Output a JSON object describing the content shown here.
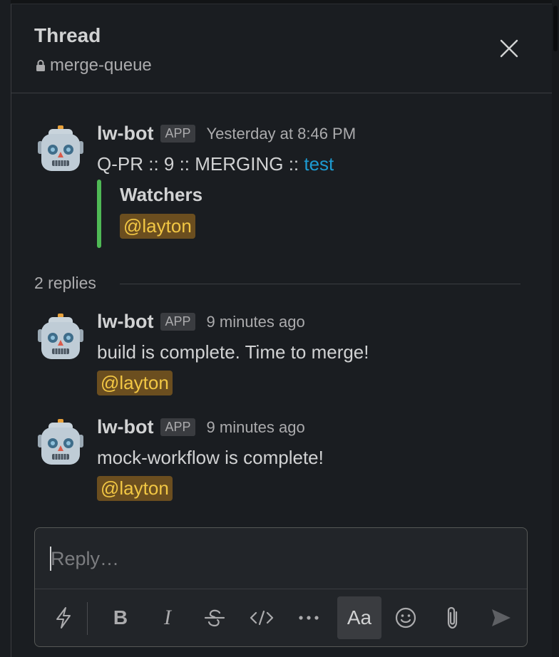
{
  "header": {
    "title": "Thread",
    "channel": "merge-queue"
  },
  "parent_message": {
    "author": "lw-bot",
    "badge": "APP",
    "time": "Yesterday at 8:46 PM",
    "text_prefix": "Q-PR :: 9 :: MERGING :: ",
    "link_text": "test",
    "attachment": {
      "title": "Watchers",
      "mention": "@layton",
      "accent_color": "#4fb955"
    }
  },
  "replies_label": "2 replies",
  "replies": [
    {
      "author": "lw-bot",
      "badge": "APP",
      "time": "9 minutes ago",
      "text": "build is complete. Time to merge!",
      "mention": "@layton"
    },
    {
      "author": "lw-bot",
      "badge": "APP",
      "time": "9 minutes ago",
      "text": "mock-workflow is complete!",
      "mention": "@layton"
    }
  ],
  "composer": {
    "placeholder": "Reply…",
    "toolbar": [
      "shortcuts-icon",
      "bold-icon",
      "italic-icon",
      "strikethrough-icon",
      "code-icon",
      "more-icon",
      "formatting-icon",
      "emoji-icon",
      "attach-icon",
      "send-icon"
    ],
    "format_label": "Aa"
  },
  "colors": {
    "background": "#1a1d21",
    "link": "#1d9bd1",
    "mention_bg": "#6b4e1f",
    "mention_text": "#f2c744"
  }
}
